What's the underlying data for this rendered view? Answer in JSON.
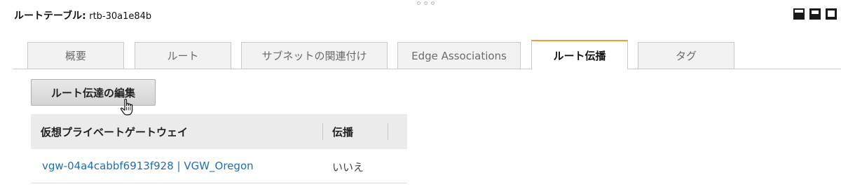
{
  "header": {
    "label": "ルートテーブル:",
    "route_table_id": "rtb-30a1e84b"
  },
  "tabs": [
    {
      "label": "概要"
    },
    {
      "label": "ルート"
    },
    {
      "label": "サブネットの関連付け"
    },
    {
      "label": "Edge Associations"
    },
    {
      "label": "ルート伝播",
      "active": true
    },
    {
      "label": "タグ"
    }
  ],
  "colors": {
    "active_tab_accent": "#e7a03c",
    "link": "#1f6fb2"
  },
  "actions": {
    "edit_button": "ルート伝達の編集"
  },
  "table": {
    "columns": [
      "仮想プライベートゲートウェイ",
      "伝播"
    ],
    "rows": [
      {
        "gateway": "vgw-04a4cabbf6913f928 | VGW_Oregon",
        "propagation": "いいえ"
      }
    ]
  },
  "icons": [
    "drag-handle-icon",
    "layout-icon",
    "hand-pointer-cursor-icon"
  ]
}
